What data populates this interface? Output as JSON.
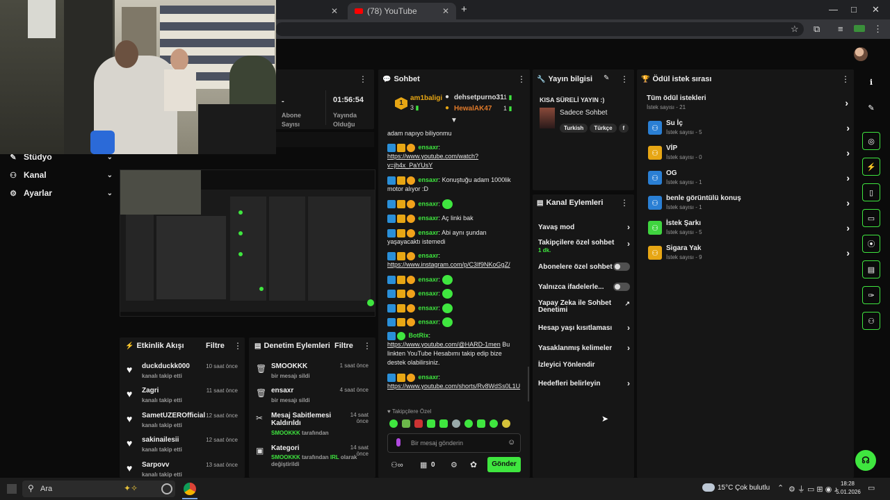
{
  "browser": {
    "tab_title": "(78) YouTube",
    "new_tab": "+",
    "minimize": "—",
    "restore": "□",
    "close": "✕"
  },
  "nav": {
    "items": [
      {
        "label": "Stüdyo",
        "icon": "studio-icon"
      },
      {
        "label": "Kanal",
        "icon": "channel-icon"
      },
      {
        "label": "Ayarlar",
        "icon": "gear-icon"
      }
    ]
  },
  "stats": {
    "dash": "-",
    "time": "01:56:54",
    "sub_label": "Abone\nSayısı",
    "live_label": "Yayında\nOlduğu"
  },
  "events": {
    "title": "Etkinlik Akışı",
    "filter": "Filtre",
    "items": [
      {
        "name": "duckduckk000",
        "sub": "kanalı takip etti",
        "time": "10 saat önce"
      },
      {
        "name": "Zagri",
        "sub": "kanalı takip etti",
        "time": "11 saat önce"
      },
      {
        "name": "SametUZEROfficial",
        "sub": "kanalı takip etti",
        "time": "12 saat önce"
      },
      {
        "name": "sakinailesii",
        "sub": "kanalı takip etti",
        "time": "12 saat önce"
      },
      {
        "name": "Sarpovv",
        "sub": "kanalı takip etti",
        "time": "13 saat önce"
      }
    ]
  },
  "mod": {
    "title": "Denetim Eylemleri",
    "filter": "Filtre",
    "items": [
      {
        "name": "SMOOKKK",
        "sub": "bir mesajı sildi",
        "time": "1 saat önce"
      },
      {
        "name": "ensaxr",
        "sub": "bir mesajı sildi",
        "time": "4 saat önce"
      },
      {
        "name": "Mesaj Sabitlemesi Kaldırıldı",
        "sub_user": "SMOOKKK",
        "sub": "tarafından",
        "time": "14 saat önce"
      },
      {
        "name": "Kategori",
        "sub_user": "SMOOKKK",
        "sub": "tarafından",
        "sub_user2": "IRL",
        "sub2": "olarak değiştirildi",
        "time": "14 saat önce"
      }
    ]
  },
  "chat": {
    "title": "Sohbet",
    "top1": {
      "name": "am1baligi",
      "count": "3"
    },
    "top2": {
      "name": "dehsetpurno31",
      "count": "1"
    },
    "top3": {
      "name": "HewalAK47",
      "count": "1"
    },
    "messages": [
      {
        "user": "",
        "text": "adam napıyo biliyonmu"
      },
      {
        "user": "ensaxr",
        "text": "",
        "link": "https://www.youtube.com/watch?v=jh4x_PaYUsY"
      },
      {
        "user": "ensaxr",
        "text": "Konuştuğu adam 1000lik motor alıyor :D"
      },
      {
        "user": "ensaxr",
        "text": "",
        "emote": true
      },
      {
        "user": "ensaxr",
        "text": "Aç linki bak"
      },
      {
        "user": "ensaxr",
        "text": "Abi aynı şundan yaşayacaktı istemedi"
      },
      {
        "user": "ensaxr",
        "text": "",
        "link": "https://www.instagram.com/p/C3If9NKoGgZ/"
      },
      {
        "user": "ensaxr",
        "text": "",
        "emote": true
      },
      {
        "user": "ensaxr",
        "text": "",
        "emote": true
      },
      {
        "user": "ensaxr",
        "text": "",
        "emote": true
      },
      {
        "user": "ensaxr",
        "text": "",
        "emote": true
      },
      {
        "user": "BotRix",
        "link": "https://www.youtube.com/@HARD-1men",
        "text": "Bu linkten YouTube Hesabımı takip edip bize destek olabilirsiniz."
      },
      {
        "user": "ensaxr",
        "text": "",
        "link": "https://www.youtube.com/shorts/Rv8WdSs0L1U"
      }
    ],
    "followers_only": "Takipçilere Özel",
    "input_placeholder": "Bir mesaj gönderin",
    "cart_count": "0",
    "send": "Gönder"
  },
  "stream_info": {
    "title": "Yayın bilgisi",
    "stream_title": "KISA SÜRELİ YAYIN :)",
    "category": "Sadece Sohbet",
    "tags": [
      "Turkish",
      "Türkçe",
      "f"
    ]
  },
  "channel_actions": {
    "title": "Kanal Eylemleri",
    "items": [
      {
        "label": "Yavaş mod",
        "kind": "chev"
      },
      {
        "label": "Takipçilere özel sohbet",
        "sub": "1 dk.",
        "kind": "chev"
      },
      {
        "label": "Abonelere özel sohbet",
        "kind": "toggle"
      },
      {
        "label": "Yalnızca ifadelerle...",
        "kind": "toggle"
      },
      {
        "label": "Yapay Zeka ile Sohbet Denetimi",
        "kind": "ext"
      },
      {
        "label": "Hesap yaşı kısıtlaması",
        "kind": "chev"
      },
      {
        "label": "Yasaklanmış kelimeler",
        "kind": "chev"
      },
      {
        "label": "İzleyici Yönlendir",
        "kind": "none"
      },
      {
        "label": "Hedefleri belirleyin",
        "kind": "chev"
      }
    ]
  },
  "rewards": {
    "title": "Ödül istek sırası",
    "all_label": "Tüm ödül istekleri",
    "all_sub": "İstek sayısı - 21",
    "items": [
      {
        "name": "Su İç",
        "sub": "İstek sayısı - 5",
        "color": "#2a7fd4"
      },
      {
        "name": "VİP",
        "sub": "İstek sayısı - 0",
        "color": "#e7a614"
      },
      {
        "name": "OG",
        "sub": "İstek sayısı - 1",
        "color": "#2a7fd4"
      },
      {
        "name": "benle görüntülü konuş",
        "sub": "İstek sayısı - 1",
        "color": "#2a7fd4"
      },
      {
        "name": "İstek Şarkı",
        "sub": "İstek sayısı - 5",
        "color": "#3fd43f"
      },
      {
        "name": "Sigara Yak",
        "sub": "İstek sayısı - 9",
        "color": "#e7a614"
      }
    ]
  },
  "taskbar": {
    "search": "Ara",
    "weather": "15°C  Çok bulutlu",
    "time": "18:28",
    "date": "5.01.2026"
  },
  "colors": {
    "accent": "#3fe63f",
    "panel": "#161616",
    "background": "#0b0b0b"
  }
}
